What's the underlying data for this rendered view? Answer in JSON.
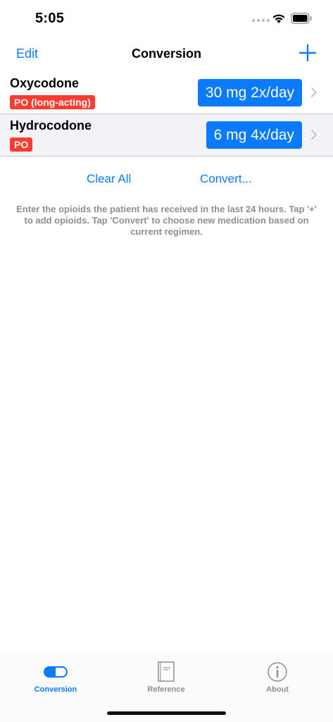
{
  "status_bar": {
    "time": "5:05",
    "icons": [
      "cellular-dots-icon",
      "wifi-icon",
      "battery-icon"
    ]
  },
  "nav": {
    "edit_label": "Edit",
    "title": "Conversion",
    "add_icon": "plus-icon"
  },
  "medications": [
    {
      "name": "Oxycodone",
      "route": "PO (long-acting)",
      "dose": "30 mg 2x/day"
    },
    {
      "name": "Hydrocodone",
      "route": "PO",
      "dose": "6 mg 4x/day"
    }
  ],
  "actions": {
    "clear_label": "Clear All",
    "convert_label": "Convert..."
  },
  "hint": "Enter the opioids the patient has received in the last 24 hours. Tap '+' to add opioids. Tap 'Convert' to choose new medication based on current regimen.",
  "tabs": [
    {
      "label": "Conversion",
      "icon": "pill-toggle-icon",
      "active": true
    },
    {
      "label": "Reference",
      "icon": "book-icon",
      "active": false
    },
    {
      "label": "About",
      "icon": "info-icon",
      "active": false
    }
  ],
  "colors": {
    "accent": "#0a7aff",
    "badge": "#ff3b30",
    "inactive": "#8e8e93"
  }
}
